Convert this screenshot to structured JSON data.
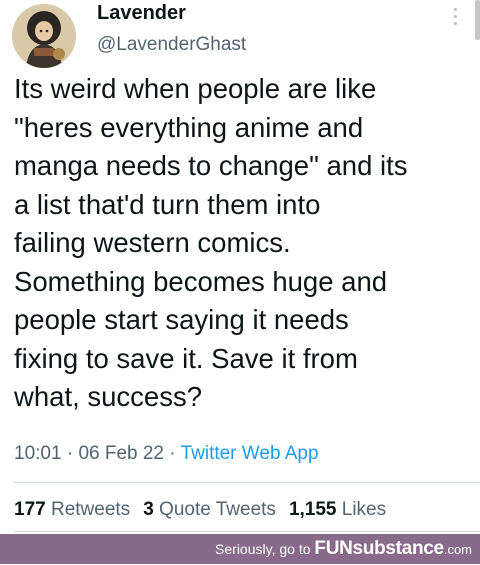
{
  "tweet": {
    "display_name": "Lavender",
    "handle": "@LavenderGhast",
    "text_lines": [
      "Its weird when people are like",
      "\"heres everything anime and",
      "manga needs to change\" and its",
      "a list that'd turn them into",
      "failing western comics.",
      "Something becomes huge and",
      "people start saying it needs",
      "fixing to save it. Save it from",
      "what, success?"
    ],
    "time": "10:01",
    "date": "06 Feb 22",
    "separator": "·",
    "source": "Twitter Web App",
    "retweets_count": "177",
    "retweets_label": "Retweets",
    "quote_count": "3",
    "quote_label": "Quote Tweets",
    "likes_count": "1,155",
    "likes_label": "Likes"
  },
  "footer": {
    "prefix": "Seriously, go to ",
    "brand": "FUNsubstance",
    "tld": ".com",
    "bar_color": "#8a6a8b"
  },
  "icons": {
    "more": "more-vertical-icon",
    "avatar": "profile-avatar"
  }
}
